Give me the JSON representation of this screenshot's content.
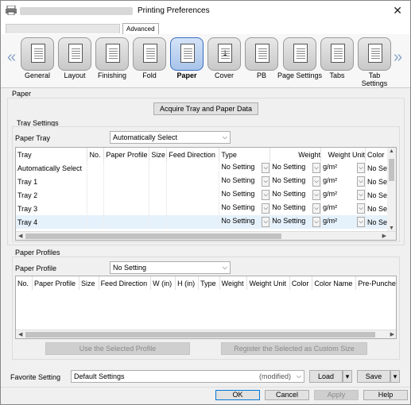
{
  "window": {
    "title": "Printing Preferences",
    "close_glyph": "✕"
  },
  "tabs": {
    "advanced_label": "Advanced"
  },
  "ribbon": {
    "items": [
      {
        "label": "General",
        "icon": "general-icon"
      },
      {
        "label": "Layout",
        "icon": "layout-icon"
      },
      {
        "label": "Finishing",
        "icon": "finishing-icon"
      },
      {
        "label": "Fold",
        "icon": "fold-icon"
      },
      {
        "label": "Paper",
        "icon": "paper-icon",
        "selected": true
      },
      {
        "label": "Cover",
        "icon": "cover-icon"
      },
      {
        "label": "PB",
        "icon": "pb-icon"
      },
      {
        "label": "Page Settings",
        "icon": "page-settings-icon"
      },
      {
        "label": "Tabs",
        "icon": "tabs-icon"
      },
      {
        "label": "Tab Settings",
        "icon": "tab-settings-icon"
      }
    ],
    "cover_badge": "1",
    "left_arrow": "«",
    "right_arrow": "»"
  },
  "paper": {
    "section_label": "Paper",
    "acquire_button": "Acquire Tray and Paper Data"
  },
  "tray_settings": {
    "section_label": "Tray Settings",
    "paper_tray_label": "Paper Tray",
    "paper_tray_value": "Automatically Select",
    "columns": [
      "Tray",
      "No.",
      "Paper Profile",
      "Size",
      "Feed Direction",
      "Type",
      "Weight",
      "Weight Unit",
      "Color"
    ],
    "rows": [
      {
        "tray": "Automatically Select",
        "type": "No Setting",
        "weight": "No Setting",
        "unit": "g/m²",
        "color": "No Se"
      },
      {
        "tray": "Tray 1",
        "type": "No Setting",
        "weight": "No Setting",
        "unit": "g/m²",
        "color": "No Se"
      },
      {
        "tray": "Tray 2",
        "type": "No Setting",
        "weight": "No Setting",
        "unit": "g/m²",
        "color": "No Se"
      },
      {
        "tray": "Tray 3",
        "type": "No Setting",
        "weight": "No Setting",
        "unit": "g/m²",
        "color": "No Se"
      },
      {
        "tray": "Tray 4",
        "type": "No Setting",
        "weight": "No Setting",
        "unit": "g/m²",
        "color": "No Se"
      }
    ]
  },
  "paper_profiles": {
    "section_label": "Paper Profiles",
    "paper_profile_label": "Paper Profile",
    "paper_profile_value": "No Setting",
    "columns": [
      "No.",
      "Paper Profile",
      "Size",
      "Feed Direction",
      "W (in)",
      "H (in)",
      "Type",
      "Weight",
      "Weight Unit",
      "Color",
      "Color Name",
      "Pre-Punche"
    ],
    "use_selected_button": "Use the Selected Profile",
    "register_button": "Register the Selected as Custom Size"
  },
  "favorite": {
    "label": "Favorite Setting",
    "value": "Default Settings",
    "modified": "(modified)",
    "load_button": "Load",
    "save_button": "Save"
  },
  "footer": {
    "ok": "OK",
    "cancel": "Cancel",
    "apply": "Apply",
    "help": "Help"
  }
}
